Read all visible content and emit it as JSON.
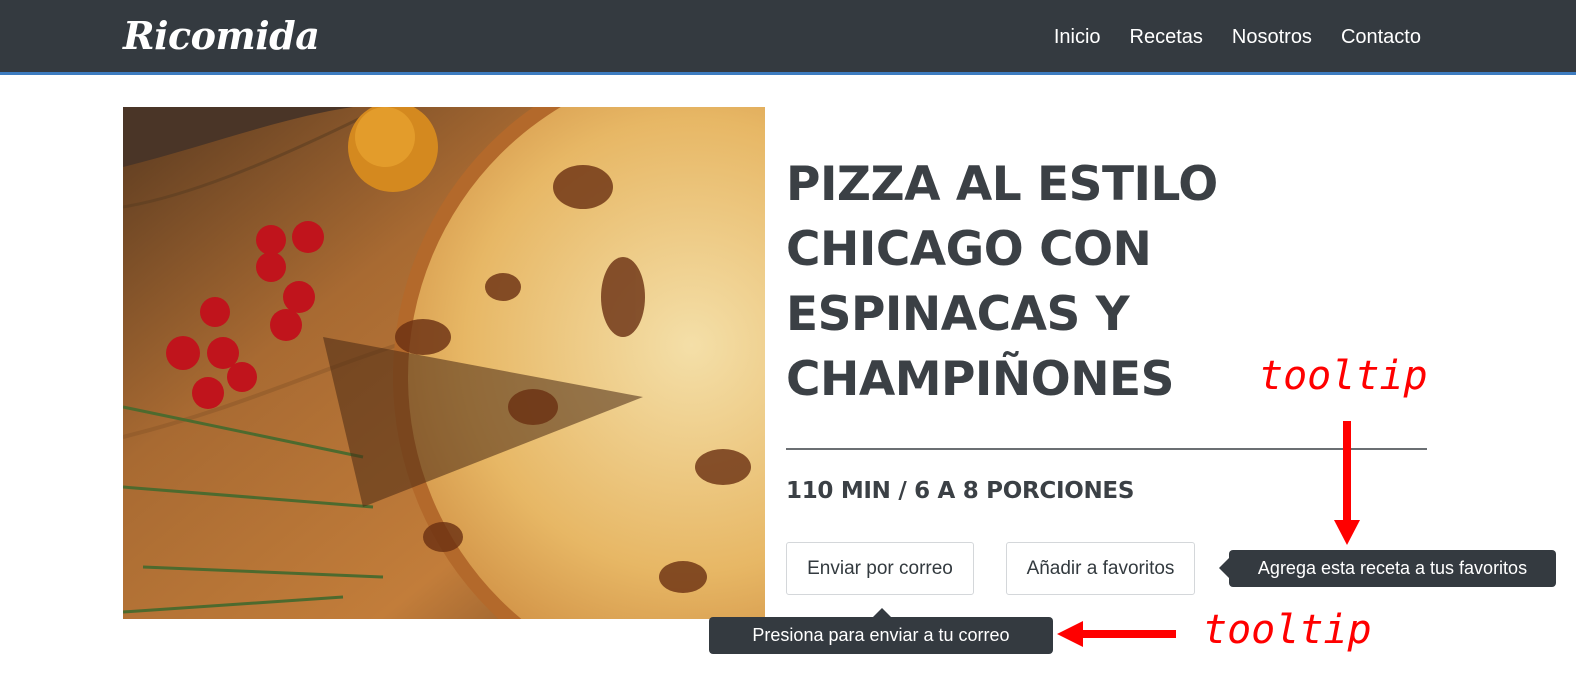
{
  "navbar": {
    "brand": "Ricomida",
    "links": [
      "Inicio",
      "Recetas",
      "Nosotros",
      "Contacto"
    ]
  },
  "hero": {
    "image": "pizza-photo"
  },
  "recipe": {
    "title": "PIZZA AL ESTILO CHICAGO CON ESPINACAS Y CHAMPIÑONES",
    "meta": "110 MIN / 6 A 8 PORCIONES"
  },
  "actions": {
    "email_label": "Enviar por correo",
    "favorites_label": "Añadir a favoritos"
  },
  "tooltips": {
    "favorites": "Agrega esta receta a tus favoritos",
    "email": "Presiona para enviar a tu correo"
  },
  "annotations": {
    "top_label": "tooltip",
    "bottom_label": "tooltip",
    "color": "#ff0000"
  },
  "colors": {
    "navbar": "#343a40",
    "navbar_accent": "#3d7cc0",
    "text": "#3b4045"
  }
}
